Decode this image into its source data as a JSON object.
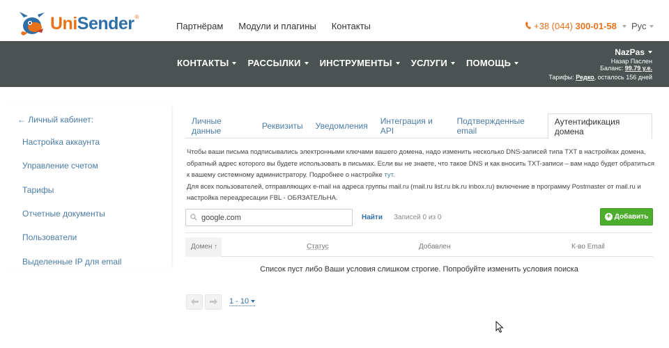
{
  "header": {
    "logo": {
      "part1": "Uni",
      "part2": "Sender",
      "reg": "®"
    },
    "nav": [
      "Партнёрам",
      "Модули и плагины",
      "Контакты"
    ],
    "phone": {
      "prefix": "+38 (044) ",
      "main": "300-01-58"
    },
    "lang": "Рус"
  },
  "menu": {
    "items": [
      "КОНТАКТЫ",
      "РАССЫЛКИ",
      "ИНСТРУМЕНТЫ",
      "УСЛУГИ",
      "ПОМОЩЬ"
    ],
    "user": {
      "login": "NazPas",
      "name": "Назар Паслен",
      "balance_label": "Баланс: ",
      "balance_value": "99.79 у.е.",
      "tariff_label": "Тарифы: ",
      "tariff_value": "Редко",
      "tariff_rest": ", осталось 156 дней"
    }
  },
  "sidebar": {
    "back": "← Личный кабинет:",
    "items": [
      "Настройка аккаунта",
      "Управление счетом",
      "Тарифы",
      "Отчетные документы",
      "Пользователи",
      "Выделенные IP для email"
    ]
  },
  "tabs": [
    "Личные данные",
    "Реквизиты",
    "Уведомления",
    "Интеграция и API",
    "Подтвержденные email",
    "Аутентификация домена"
  ],
  "active_tab": 5,
  "description": {
    "p1_text": "Чтобы ваши письма подписывались электронными ключами вашего домена, надо изменить несколько DNS-записей типа TXT в настройках домена, обратный адрес которого вы будете использовать в письмах. Если вы не знаете, что такое DNS и как вносить TXT-записи – вам надо будет обратиться к вашему системному администратору. Подробнее о настройке ",
    "p1_link": "тут",
    "p1_end": ".",
    "p2": " Для всех пользователей, отправляющих e-mail на адреса группы mail.ru (mail.ru list.ru bk.ru inbox.ru) включение в программу Postmaster от mail.ru и настройка переадресации FBL - ОБЯЗАТЕЛЬНА."
  },
  "search": {
    "value": "google.com",
    "button": "Найти",
    "records": "Записей 0 из 0"
  },
  "add_button": "Добавить",
  "table": {
    "columns": [
      "Домен ↑",
      "Статус",
      "Добавлен",
      "К-во Email"
    ],
    "empty": "Список пуст либо Ваши условия слишком строгие. Попробуйте изменить условия поиска"
  },
  "pager": {
    "range": "1 - 10"
  },
  "colors": {
    "accent": "#e8711a",
    "brand": "#2f6fa7",
    "nav_bg": "#4b5252",
    "add_green": "#4cae2c",
    "link": "#4a7ba6"
  }
}
